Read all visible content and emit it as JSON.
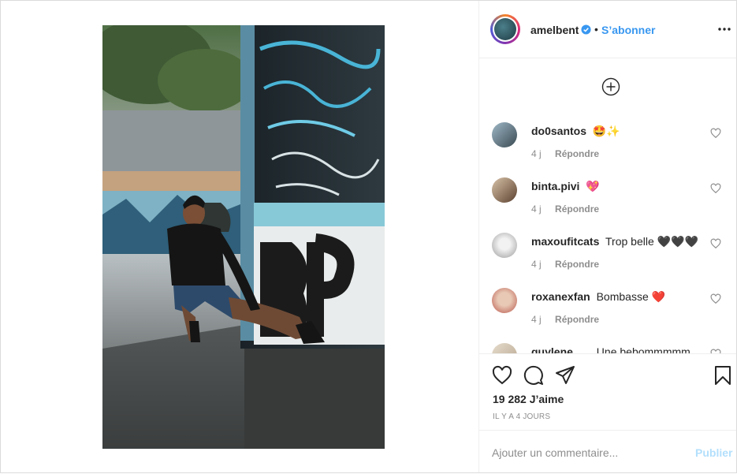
{
  "post": {
    "username": "amelbent",
    "verified_icon": "verified-badge-icon",
    "separator": "•",
    "follow_label": "S’abonner",
    "more_icon": "more-options-icon",
    "load_more_icon": "plus-circle-icon",
    "likes_text": "19 282 J’aime",
    "time_ago": "IL Y A 4 JOURS",
    "comment_placeholder": "Ajouter un commentaire...",
    "publish_label": "Publier",
    "accent_color": "#3897f0",
    "publish_disabled_color": "#b2dffc"
  },
  "comments": [
    {
      "user": "do0santos",
      "text": "🤩✨",
      "time": "4 j",
      "reply": "Répondre"
    },
    {
      "user": "binta.pivi",
      "text": "💖",
      "time": "4 j",
      "reply": "Répondre"
    },
    {
      "user": "maxoufitcats",
      "text": "Trop belle 🖤🖤🖤",
      "time": "4 j",
      "reply": "Répondre"
    },
    {
      "user": "roxanexfan",
      "text": "Bombasse ❤️",
      "time": "4 j",
      "reply": "Répondre"
    },
    {
      "user": "guylene",
      "text": "Une bebommmmm",
      "time": "",
      "reply": ""
    }
  ],
  "actions": {
    "like_icon": "heart-icon",
    "comment_icon": "comment-icon",
    "share_icon": "share-paper-plane-icon",
    "save_icon": "bookmark-icon"
  }
}
